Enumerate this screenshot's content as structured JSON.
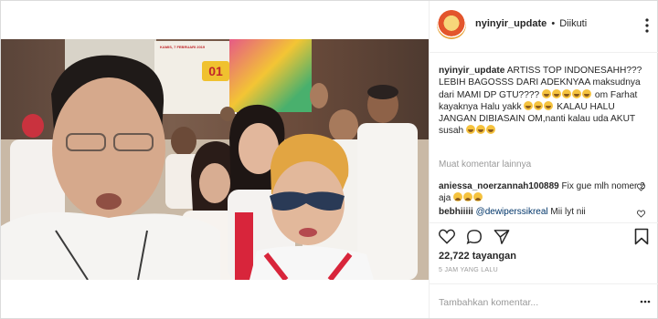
{
  "post": {
    "username": "nyinyir_update",
    "separator": "•",
    "follow_status": "Diikuti",
    "caption_user": "nyinyir_update",
    "caption_parts": [
      "ARTISS TOP INDONESAHH???LEBIH BAGOSSS DARI ADEKNYAA maksudnya dari MAMI DP GTU????",
      " om Farhat kayaknya Halu yakk",
      "KALAU HALU JANGAN DIBIASAIN OM,nanti kalau uda AKUT susah"
    ],
    "load_more": "Muat komentar lainnya",
    "comments": [
      {
        "user": "aniessa_noerzannah100889",
        "text": "Fix gue mlh nomer 2 aja"
      },
      {
        "user": "bebhiiiii",
        "mention": "@dewiperssikreal",
        "text": "Mii lyt nii"
      }
    ],
    "views": "22,722 tayangan",
    "time_ago": "5 JAM YANG LALU",
    "add_comment_placeholder": "Tambahkan komentar..."
  },
  "video_overlay": {
    "banner_text": "KAMIS, 7 FEBRUARI 2019",
    "badge": "01"
  },
  "colors": {
    "border": "#dbdbdb",
    "text": "#262626",
    "muted": "#999999",
    "mention": "#003569"
  }
}
